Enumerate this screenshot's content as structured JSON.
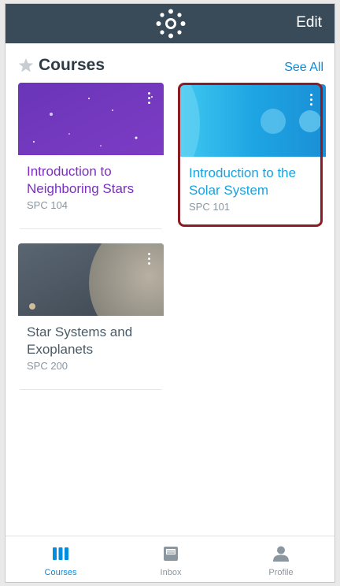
{
  "header": {
    "logo_icon": "canvas-logo-icon",
    "edit_label": "Edit",
    "background": "#394b58"
  },
  "section": {
    "star_icon": "star-icon",
    "title": "Courses",
    "see_all_label": "See All"
  },
  "courses": [
    {
      "title": "Introduction to Neighboring Stars",
      "code": "SPC 104",
      "title_color": "#7a2fbf",
      "thumbnail": "purple starfield"
    },
    {
      "title": "Introduction to the Solar System",
      "code": "SPC 101",
      "title_color": "#18a2e0",
      "thumbnail": "blue planets"
    },
    {
      "title": "Star Systems and Exoplanets",
      "code": "SPC 200",
      "title_color": "#4a5a66",
      "thumbnail": "grey exoplanet"
    }
  ],
  "tabbar": {
    "tabs": [
      {
        "label": "Courses",
        "icon": "courses-icon",
        "active": true
      },
      {
        "label": "Inbox",
        "icon": "inbox-icon",
        "active": false
      },
      {
        "label": "Profile",
        "icon": "profile-icon",
        "active": false
      }
    ],
    "active_color": "#008ee2",
    "inactive_color": "#8b969e"
  },
  "highlight_color": "#8b1c24"
}
